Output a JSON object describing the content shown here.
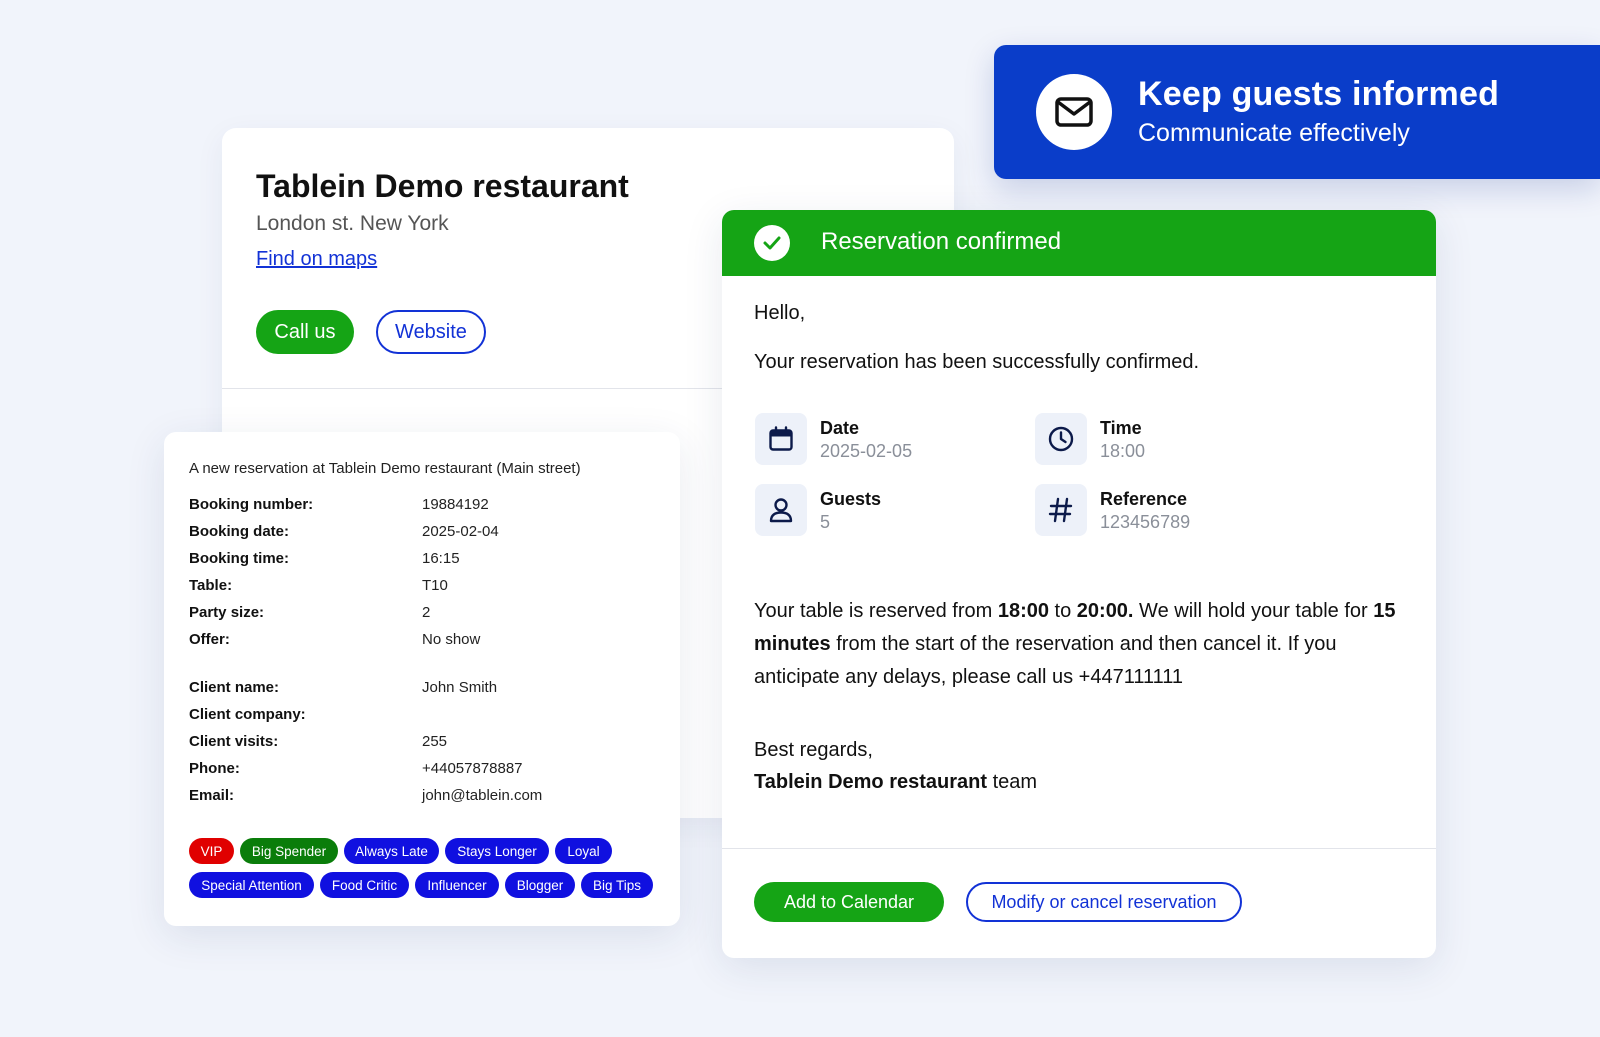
{
  "banner": {
    "title": "Keep guests informed",
    "subtitle": "Communicate effectively",
    "icon": "envelope-icon",
    "color": "#0a3dc9"
  },
  "restaurant": {
    "name": "Tablein Demo restaurant",
    "address": "London st. New York",
    "maps_link": "Find on maps",
    "call_button": "Call us",
    "website_button": "Website"
  },
  "booking": {
    "heading": "A new reservation at Tablein Demo restaurant (Main street)",
    "rows": [
      {
        "label": "Booking number:",
        "value": "19884192"
      },
      {
        "label": "Booking date:",
        "value": "2025-02-04"
      },
      {
        "label": "Booking time:",
        "value": "16:15"
      },
      {
        "label": "Table:",
        "value": "T10"
      },
      {
        "label": "Party size:",
        "value": "2"
      },
      {
        "label": "Offer:",
        "value": "No show"
      }
    ],
    "client_rows": [
      {
        "label": "Client name:",
        "value": "John Smith"
      },
      {
        "label": "Client company:",
        "value": ""
      },
      {
        "label": "Client visits:",
        "value": "255"
      },
      {
        "label": "Phone:",
        "value": "+44057878887"
      },
      {
        "label": "Email:",
        "value": "john@tablein.com"
      }
    ],
    "tags": [
      {
        "label": "VIP",
        "color": "#e00000"
      },
      {
        "label": "Big Spender",
        "color": "#0a7d0a"
      },
      {
        "label": "Always Late",
        "color": "#1010e0"
      },
      {
        "label": "Stays Longer",
        "color": "#1010e0"
      },
      {
        "label": "Loyal",
        "color": "#1010e0"
      },
      {
        "label": "Special Attention",
        "color": "#1010e0"
      },
      {
        "label": "Food Critic",
        "color": "#1010e0"
      },
      {
        "label": "Influencer",
        "color": "#1010e0"
      },
      {
        "label": "Blogger",
        "color": "#1010e0"
      },
      {
        "label": "Big Tips",
        "color": "#1010e0"
      }
    ]
  },
  "confirmation": {
    "header": "Reservation confirmed",
    "greeting": "Hello,",
    "message": "Your reservation has been successfully confirmed.",
    "details": [
      {
        "label": "Date",
        "value": "2025-02-05",
        "icon": "calendar-icon"
      },
      {
        "label": "Time",
        "value": "18:00",
        "icon": "clock-icon"
      },
      {
        "label": "Guests",
        "value": "5",
        "icon": "user-icon"
      },
      {
        "label": "Reference",
        "value": "123456789",
        "icon": "hash-icon"
      }
    ],
    "para": {
      "t1": "Your table is reserved from ",
      "b1": "18:00",
      "t2": " to ",
      "b2": "20:00.",
      "t3": " We will hold your table for ",
      "b3": "15 minutes",
      "t4": " from the start of the reservation and then cancel it. If you anticipate any delays, please call us +447111111"
    },
    "regards": "Best regards,",
    "team_name": "Tablein Demo restaurant",
    "team_suffix": " team",
    "calendar_button": "Add to Calendar",
    "modify_button": "Modify or cancel reservation",
    "accent": "#15a415",
    "link_color": "#1232d6"
  }
}
